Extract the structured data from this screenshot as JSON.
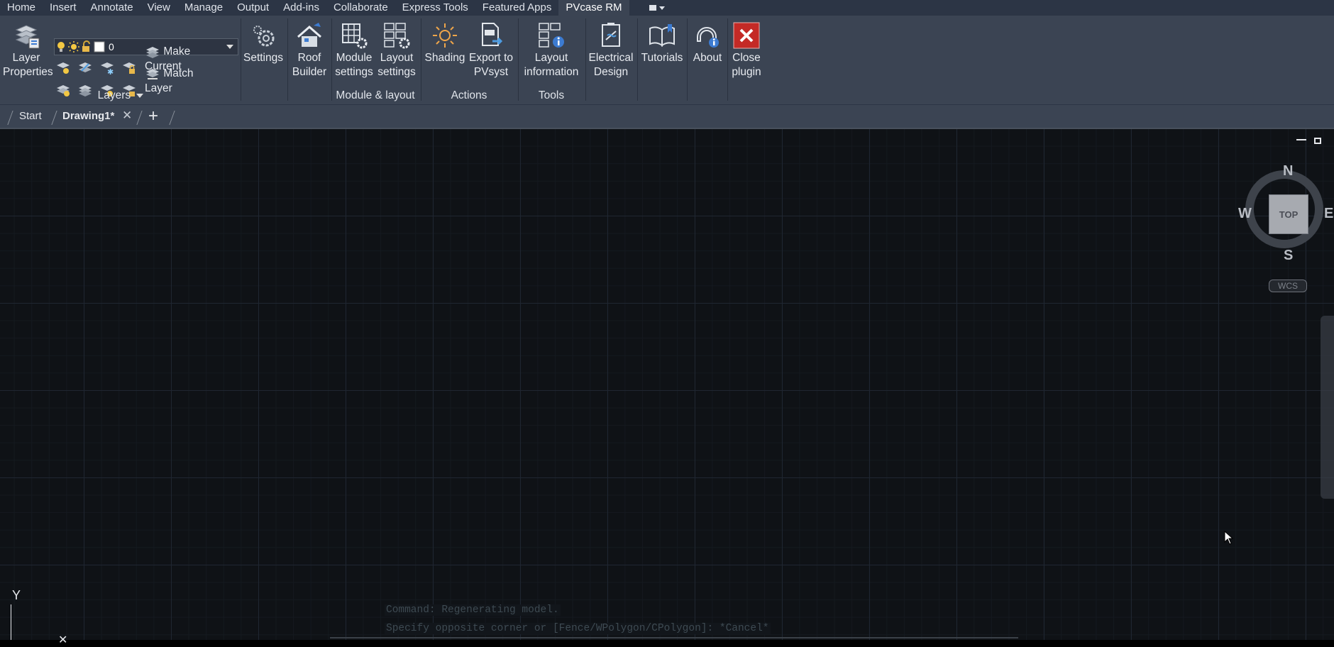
{
  "ribbon_tabs": [
    "Home",
    "Insert",
    "Annotate",
    "View",
    "Manage",
    "Output",
    "Add-ins",
    "Collaborate",
    "Express Tools",
    "Featured Apps",
    "PVcase RM"
  ],
  "active_tab": "PVcase RM",
  "layers_panel": {
    "layer_properties_line1": "Layer",
    "layer_properties_line2": "Properties",
    "current_layer": "0",
    "make_current": "Make Current",
    "match_layer": "Match Layer",
    "panel_label": "Layers"
  },
  "pvcase": {
    "settings": "Settings",
    "roof_builder_1": "Roof",
    "roof_builder_2": "Builder",
    "module_settings_1": "Module",
    "module_settings_2": "settings",
    "layout_settings_1": "Layout",
    "layout_settings_2": "settings",
    "module_layout_label": "Module & layout",
    "shading": "Shading",
    "export_1": "Export to",
    "export_2": "PVsyst",
    "actions_label": "Actions",
    "layout_info_1": "Layout",
    "layout_info_2": "information",
    "tools_label": "Tools",
    "electrical_1": "Electrical",
    "electrical_2": "Design",
    "tutorials": "Tutorials",
    "about": "About",
    "close_1": "Close",
    "close_2": "plugin"
  },
  "doc_tabs": {
    "start": "Start",
    "drawing": "Drawing1*"
  },
  "viewcube": {
    "north": "N",
    "south": "S",
    "east": "E",
    "west": "W",
    "face": "TOP",
    "ucs": "WCS"
  },
  "ucs_icon": {
    "y_label": "Y"
  },
  "command_history": [
    "Command: Regenerating model.",
    "Specify opposite corner or [Fence/WPolygon/CPolygon]: *Cancel*"
  ],
  "icons": [
    "layer-properties-icon",
    "settings-gear-icon",
    "roof-builder-icon",
    "module-settings-icon",
    "layout-settings-icon",
    "shading-sun-icon",
    "export-pvsyst-icon",
    "layout-information-icon",
    "electrical-design-icon",
    "tutorials-book-icon",
    "about-icon",
    "close-plugin-icon",
    "cursor-arrow-icon"
  ]
}
